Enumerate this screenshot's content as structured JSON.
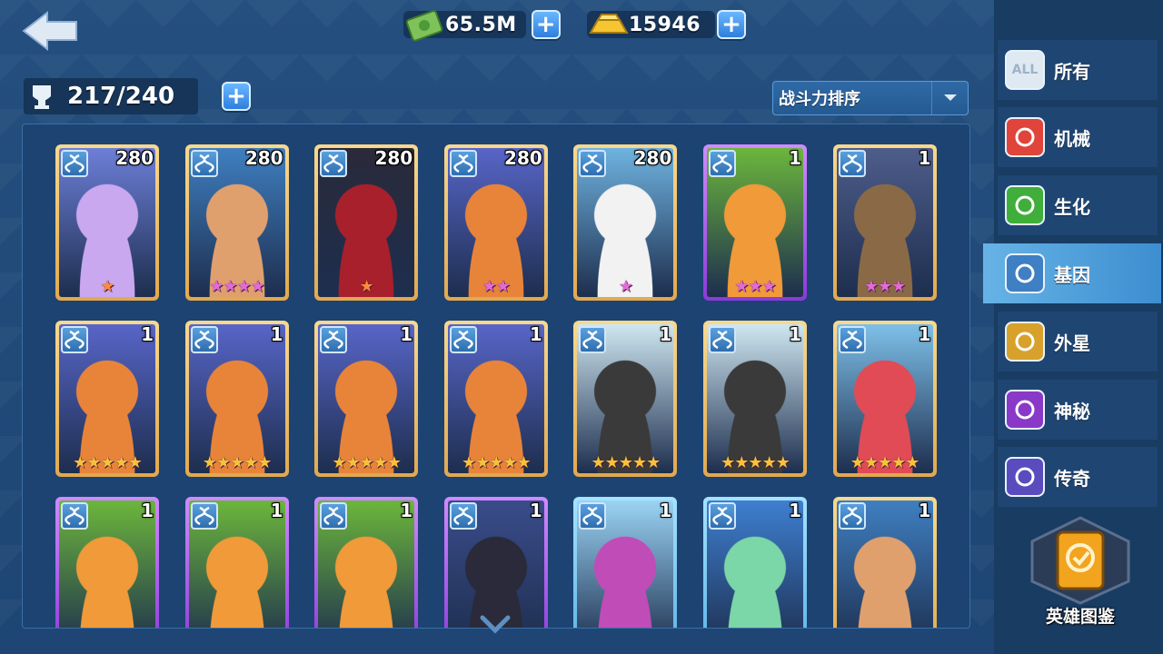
{
  "header": {
    "money": "65.5M",
    "gold": "15946"
  },
  "capacity": {
    "value": "217/240"
  },
  "sort": {
    "label": "战斗力排序"
  },
  "heroes": [
    {
      "level": "280",
      "stars": 1,
      "frame": "gold",
      "art": "robot-knight"
    },
    {
      "level": "280",
      "stars": 4,
      "frame": "gold",
      "art": "cyber-girl"
    },
    {
      "level": "280",
      "stars": 1,
      "frame": "gold",
      "art": "red-nun"
    },
    {
      "level": "280",
      "stars": 2,
      "frame": "gold",
      "art": "goggle-brute"
    },
    {
      "level": "280",
      "stars": 1,
      "frame": "gold",
      "art": "eagle"
    },
    {
      "level": "1",
      "stars": 3,
      "frame": "purple",
      "art": "fox-girl"
    },
    {
      "level": "1",
      "stars": 3,
      "frame": "gold",
      "art": "werewolf"
    },
    {
      "level": "1",
      "stars": 5,
      "frame": "gold",
      "art": "goggle-brute"
    },
    {
      "level": "1",
      "stars": 5,
      "frame": "gold",
      "art": "goggle-brute"
    },
    {
      "level": "1",
      "stars": 5,
      "frame": "gold",
      "art": "goggle-brute"
    },
    {
      "level": "1",
      "stars": 5,
      "frame": "gold",
      "art": "goggle-brute"
    },
    {
      "level": "1",
      "stars": 5,
      "frame": "gold",
      "art": "panda"
    },
    {
      "level": "1",
      "stars": 5,
      "frame": "gold",
      "art": "panda"
    },
    {
      "level": "1",
      "stars": 5,
      "frame": "gold",
      "art": "boxer-girl"
    },
    {
      "level": "1",
      "stars": 0,
      "frame": "purple",
      "art": "fox-girl"
    },
    {
      "level": "1",
      "stars": 0,
      "frame": "purple",
      "art": "fox-girl"
    },
    {
      "level": "1",
      "stars": 0,
      "frame": "purple",
      "art": "fox-girl"
    },
    {
      "level": "1",
      "stars": 0,
      "frame": "purple",
      "art": "scarecrow"
    },
    {
      "level": "1",
      "stars": 0,
      "frame": "blue",
      "art": "monkey"
    },
    {
      "level": "1",
      "stars": 0,
      "frame": "blue",
      "art": "frog"
    },
    {
      "level": "1",
      "stars": 0,
      "frame": "gold",
      "art": "cyber-girl"
    }
  ],
  "sidebar": {
    "items": [
      {
        "label": "所有",
        "icon": "all-icon",
        "color": "#dfe9f2",
        "active": false
      },
      {
        "label": "机械",
        "icon": "mech-icon",
        "color": "#e0443a",
        "active": false
      },
      {
        "label": "生化",
        "icon": "flask-icon",
        "color": "#3fae3a",
        "active": false
      },
      {
        "label": "基因",
        "icon": "dna-icon",
        "color": "#3f7fc4",
        "active": true
      },
      {
        "label": "外星",
        "icon": "alien-icon",
        "color": "#d8a12c",
        "active": false
      },
      {
        "label": "神秘",
        "icon": "mystery-icon",
        "color": "#8a38c8",
        "active": false
      },
      {
        "label": "传奇",
        "icon": "legend-icon",
        "color": "#5a4bbf",
        "active": false
      }
    ],
    "codex_label": "英雄图鉴"
  },
  "colors": {
    "background": "#1f4a78",
    "sidebar": "#193c63",
    "active_tab": "#4fa0da",
    "frame_gold": "#f0c677",
    "frame_purple": "#b066f0",
    "frame_blue": "#7fcaf2",
    "star": "#e36ad8"
  }
}
